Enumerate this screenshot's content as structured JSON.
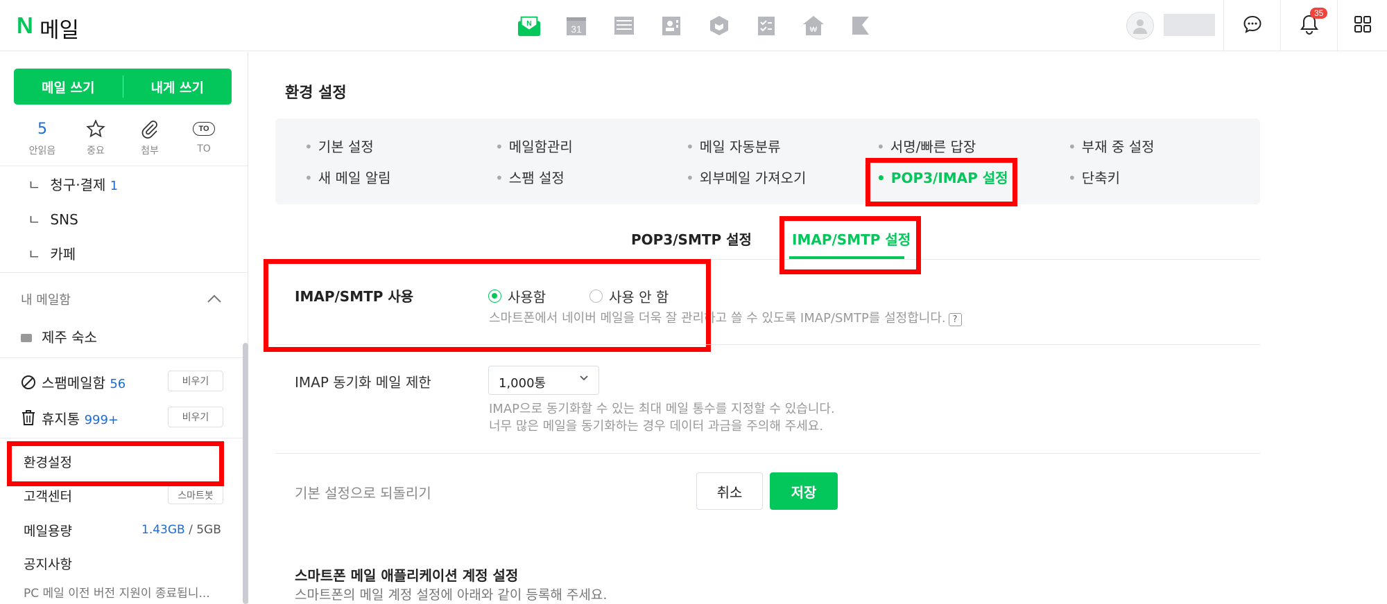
{
  "header": {
    "logo_mark": "N",
    "app_name": "메일",
    "calendar_day": "31",
    "notification_count": "35"
  },
  "sidebar": {
    "compose_label": "메일 쓰기",
    "compose_self_label": "내게 쓰기",
    "quick": [
      {
        "value": "5",
        "label": "안읽음"
      },
      {
        "value": "",
        "label": "중요"
      },
      {
        "value": "",
        "label": "첨부"
      },
      {
        "value": "TO",
        "label": "TO"
      }
    ],
    "subfolders": [
      {
        "label": "청구·결제",
        "count": "1"
      },
      {
        "label": "SNS",
        "count": ""
      },
      {
        "label": "카페",
        "count": ""
      }
    ],
    "my_mailbox_title": "내 메일함",
    "my_folder": "제주 숙소",
    "spam": {
      "label": "스팸메일함",
      "count": "56",
      "button": "비우기"
    },
    "trash": {
      "label": "휴지통",
      "count": "999+",
      "button": "비우기"
    },
    "settings_label": "환경설정",
    "support_label": "고객센터",
    "smartbot_label": "스마트봇",
    "storage_label": "메일용량",
    "storage_used": "1.43GB",
    "storage_sep": "/",
    "storage_total": "5GB",
    "notice_label": "공지사항",
    "notice_text": "PC 메일 이전 버전 지원이 종료됩니..."
  },
  "main": {
    "title": "환경 설정",
    "settings_tabs": [
      "기본 설정",
      "메일함관리",
      "메일 자동분류",
      "서명/빠른 답장",
      "부재 중 설정",
      "새 메일 알림",
      "스팸 설정",
      "외부메일 가져오기",
      "POP3/IMAP 설정",
      "단축키"
    ],
    "subtabs": [
      "POP3/SMTP 설정",
      "IMAP/SMTP 설정"
    ],
    "imap_use_label": "IMAP/SMTP 사용",
    "radio_on": "사용함",
    "radio_off": "사용 안 함",
    "imap_desc": "스마트폰에서 네이버 메일을 더욱 잘 관리하고 쓸 수 있도록 IMAP/SMTP를 설정합니다.",
    "help_glyph": "?",
    "limit_label": "IMAP 동기화 메일 제한",
    "limit_value": "1,000통",
    "limit_desc_1": "IMAP으로 동기화할 수 있는 최대 메일 통수를 지정할 수 있습니다.",
    "limit_desc_2": "너무 많은 메일을 동기화하는 경우 데이터 과금을 주의해 주세요.",
    "reset_label": "기본 설정으로 되돌리기",
    "cancel_label": "취소",
    "save_label": "저장",
    "phone_title": "스마트폰 메일 애플리케이션 계정 설정",
    "phone_desc": "스마트폰의 메일 계정 설정에 아래와 같이 등록해 주세요."
  },
  "colors": {
    "accent": "#03c75a",
    "link": "#1c6bd6",
    "highlight": "#ff0000"
  }
}
